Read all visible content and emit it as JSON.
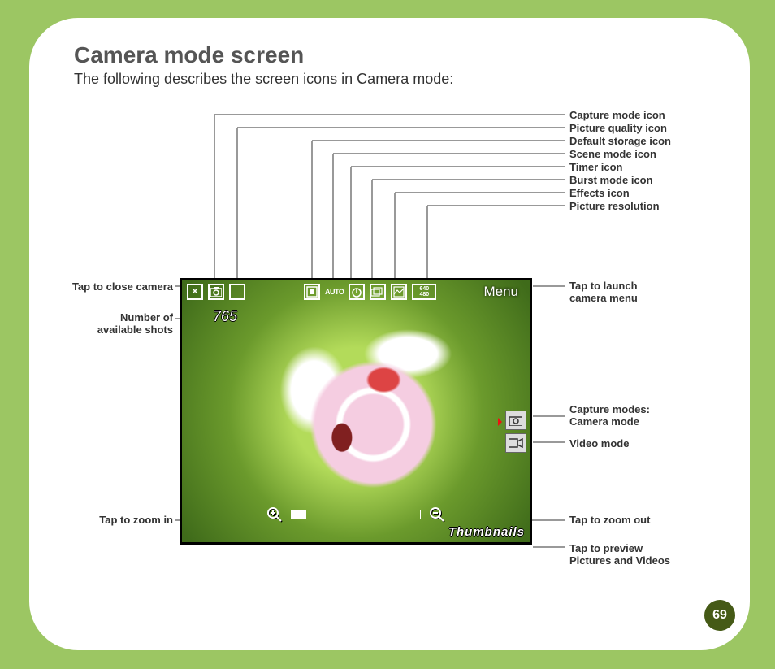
{
  "title": "Camera mode screen",
  "subtitle": "The following describes the screen icons in Camera mode:",
  "page_number": "69",
  "labels": {
    "top": [
      "Capture mode icon",
      "Picture quality icon",
      "Default storage icon",
      "Scene mode icon",
      "Timer icon",
      "Burst mode icon",
      "Effects icon",
      "Picture resolution"
    ],
    "left": {
      "close": "Tap to close camera",
      "shots_l1": "Number of",
      "shots_l2": "available shots",
      "zoom_in": "Tap to zoom in"
    },
    "right": {
      "menu_l1": "Tap to launch",
      "menu_l2": "camera menu",
      "modes_l1": "Capture modes:",
      "modes_l2": "Camera mode",
      "video": "Video mode",
      "zoom_out": "Tap to zoom out",
      "thumb_l1": "Tap to preview",
      "thumb_l2": "Pictures and Videos"
    }
  },
  "screen": {
    "shots": "765",
    "menu": "Menu",
    "thumbnails": "Thumbnails",
    "resolution": "640\n480",
    "auto": "AUTO"
  }
}
